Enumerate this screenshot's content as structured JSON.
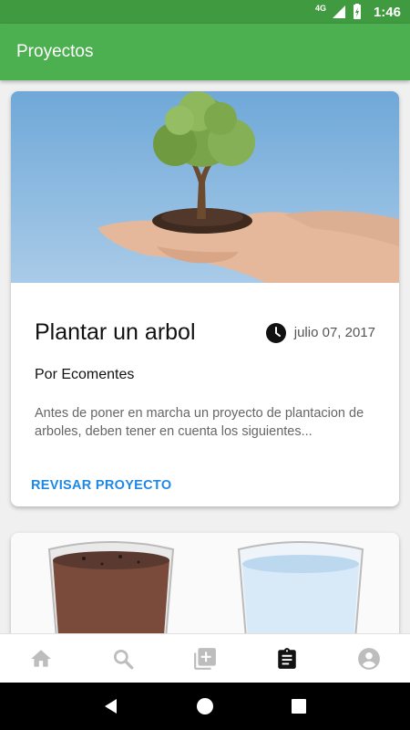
{
  "status_bar": {
    "network": "4G",
    "time": "1:46"
  },
  "app_bar": {
    "title": "Proyectos"
  },
  "cards": [
    {
      "title": "Plantar un arbol",
      "date": "julio 07, 2017",
      "author": "Por Ecomentes",
      "excerpt": "Antes de poner en marcha un proyecto de plantacion de arboles, deben tener en cuenta los siguientes...",
      "action_label": "REVISAR PROYECTO"
    }
  ],
  "bottom_nav": {
    "items": [
      {
        "icon": "home-icon",
        "active": false
      },
      {
        "icon": "search-icon",
        "active": false
      },
      {
        "icon": "add-box-icon",
        "active": false
      },
      {
        "icon": "clipboard-icon",
        "active": true
      },
      {
        "icon": "account-icon",
        "active": false
      }
    ]
  },
  "colors": {
    "status_bar": "#3f9a40",
    "app_bar": "#4caf50",
    "accent": "#1e88e5",
    "nav_inactive": "#bdbdbd",
    "nav_active": "#111111"
  }
}
